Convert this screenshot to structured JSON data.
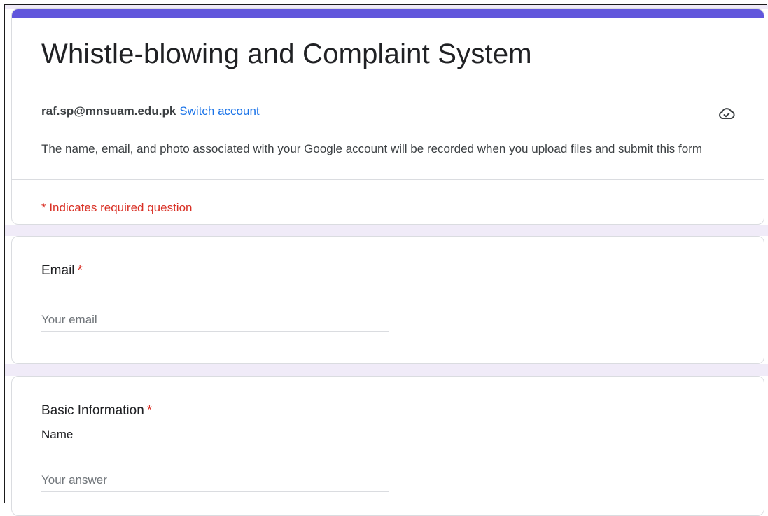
{
  "form": {
    "title": "Whistle-blowing and Complaint System",
    "accent_color": "#6156dc",
    "account_email": "raf.sp@mnsuam.edu.pk",
    "switch_account_label": "Switch account",
    "cloud_status_icon": "cloud-check-icon",
    "notice": "The name, email, and photo associated with your Google account will be recorded when you upload files and submit this form",
    "required_note": "* Indicates required question"
  },
  "questions": [
    {
      "title": "Email",
      "required_marker": "*",
      "placeholder": "Your email",
      "value": ""
    },
    {
      "title": "Basic Information",
      "required_marker": "*",
      "sub_label": "Name",
      "placeholder": "Your answer",
      "value": ""
    }
  ],
  "colors": {
    "required": "#d93025",
    "link": "#1a73e8",
    "page_background": "#f0ebf8"
  }
}
